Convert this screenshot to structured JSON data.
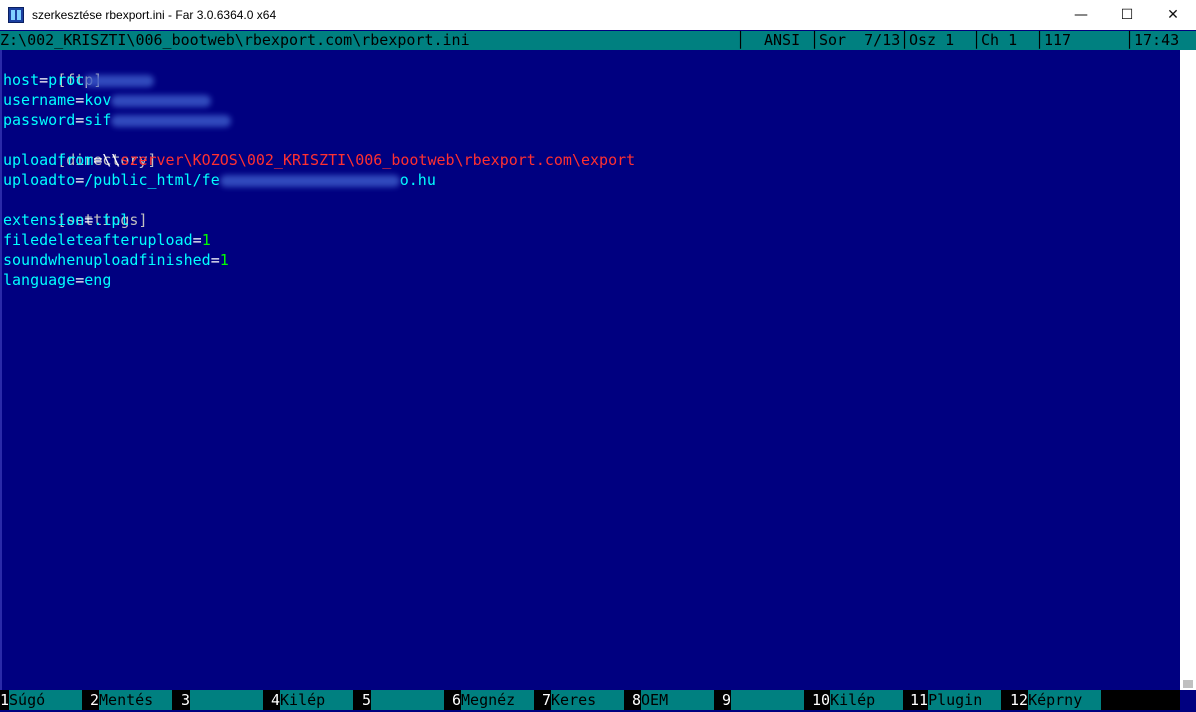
{
  "window": {
    "title": "szerkesztése rbexport.ini - Far 3.0.6364.0 x64",
    "minimize_glyph": "—",
    "maximize_glyph": "☐",
    "close_glyph": "✕"
  },
  "status": {
    "path": "Z:\\002_KRISZTI\\006_bootweb\\rbexport.com\\rbexport.ini",
    "encoding": "ANSI",
    "row": "Sor  7/13",
    "col": "Osz 1",
    "ch": "Ch 1",
    "code": "117",
    "time": "17:43"
  },
  "editor": {
    "lines": [
      {
        "type": "section",
        "text": "[ftp]"
      },
      {
        "type": "kv",
        "key": "host",
        "value": "proc",
        "blurred": true
      },
      {
        "type": "kv",
        "key": "username",
        "value": "kov",
        "blurred": true
      },
      {
        "type": "kv",
        "key": "password",
        "value": "sif",
        "blurred": true
      },
      {
        "type": "section",
        "text": "[directory]"
      },
      {
        "type": "path",
        "key": "uploadfrom",
        "prefix": "\\\\",
        "value": "szerver\\KOZOS\\002_KRISZTI\\006_bootweb\\rbexport.com\\export"
      },
      {
        "type": "kv",
        "key": "uploadto",
        "value": "/public_html/fe",
        "suffix": "o.hu",
        "blurred": true
      },
      {
        "type": "section",
        "text": "[settings]"
      },
      {
        "type": "kv",
        "key": "extension",
        "value": ".tpl"
      },
      {
        "type": "num",
        "key": "filedeleteafterupload",
        "value": "1"
      },
      {
        "type": "num",
        "key": "soundwhenuploadfinished",
        "value": "1"
      },
      {
        "type": "kv",
        "key": "language",
        "value": "eng"
      }
    ]
  },
  "keybar": [
    {
      "num": "1",
      "label": "Súgó"
    },
    {
      "num": "2",
      "label": "Mentés"
    },
    {
      "num": "3",
      "label": ""
    },
    {
      "num": "4",
      "label": "Kilép"
    },
    {
      "num": "5",
      "label": ""
    },
    {
      "num": "6",
      "label": "Megnéz"
    },
    {
      "num": "7",
      "label": "Keres"
    },
    {
      "num": "8",
      "label": "OEM"
    },
    {
      "num": "9",
      "label": ""
    },
    {
      "num": "10",
      "label": "Kilép"
    },
    {
      "num": "11",
      "label": "Plugin"
    },
    {
      "num": "12",
      "label": "Képrny"
    }
  ]
}
